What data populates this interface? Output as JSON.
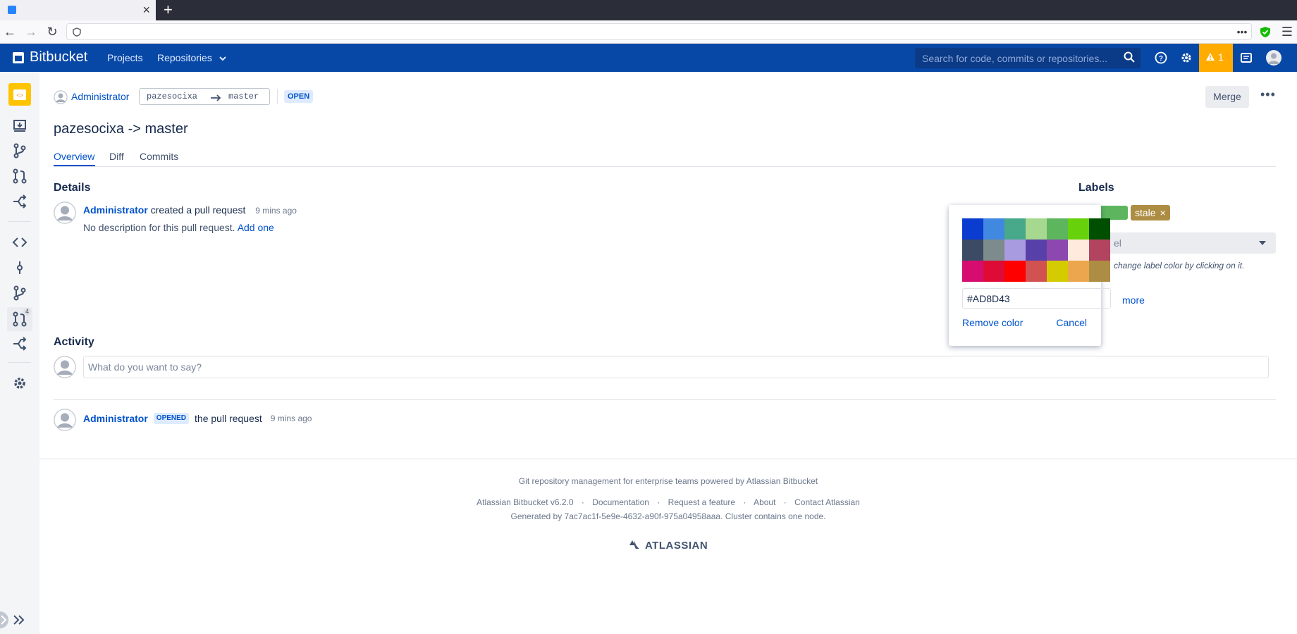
{
  "header": {
    "logo_text": "Bitbucket",
    "nav": [
      "Projects",
      "Repositories"
    ],
    "search_placeholder": "Search for code, commits or repositories...",
    "warning_count": "1"
  },
  "sidebar": {
    "pr_count": "4"
  },
  "pr": {
    "author": "Administrator",
    "source_branch": "pazesocixa",
    "target_branch": "master",
    "state": "OPEN",
    "title": "pazesocixa -> master",
    "merge_label": "Merge",
    "tabs": [
      "Overview",
      "Diff",
      "Commits"
    ]
  },
  "details": {
    "heading": "Details",
    "author": "Administrator",
    "action": "created a pull request",
    "time": "9 mins ago",
    "no_description": "No description for this pull request.",
    "add_one": "Add one"
  },
  "labels": {
    "heading": "Labels",
    "tag": "stale",
    "select_placeholder_fragment": "el",
    "hint_fragment": "change label color by clicking on it.",
    "more_fragment": "more"
  },
  "color_picker": {
    "swatches": [
      "#0a3ccf",
      "#4189e0",
      "#47a98a",
      "#a6d88f",
      "#5db65e",
      "#67d10c",
      "#004f00",
      "#3c4a63",
      "#7d8b8d",
      "#a89be0",
      "#5741a8",
      "#8d48b0",
      "#ffeadd",
      "#b34460",
      "#d60d6e",
      "#dd0b36",
      "#ff0000",
      "#d25252",
      "#d4cc00",
      "#eca64d",
      "#ad8d43"
    ],
    "hex_value": "#AD8D43",
    "remove_label": "Remove color",
    "cancel_label": "Cancel"
  },
  "activity": {
    "heading": "Activity",
    "comment_placeholder": "What do you want to say?",
    "entry_author": "Administrator",
    "entry_badge": "OPENED",
    "entry_text": "the pull request",
    "entry_time": "9 mins ago"
  },
  "footer": {
    "line1": "Git repository management for enterprise teams powered by Atlassian Bitbucket",
    "links": [
      "Atlassian Bitbucket v6.2.0",
      "Documentation",
      "Request a feature",
      "About",
      "Contact Atlassian"
    ],
    "line3": "Generated by 7ac7ac1f-5e9e-4632-a90f-975a04958aaa. Cluster contains one node.",
    "brand": "ATLASSIAN"
  },
  "colors": {
    "header_bg": "#0747a6",
    "link": "#0052cc",
    "warning": "#ffab00",
    "label": "#ad8d43"
  }
}
